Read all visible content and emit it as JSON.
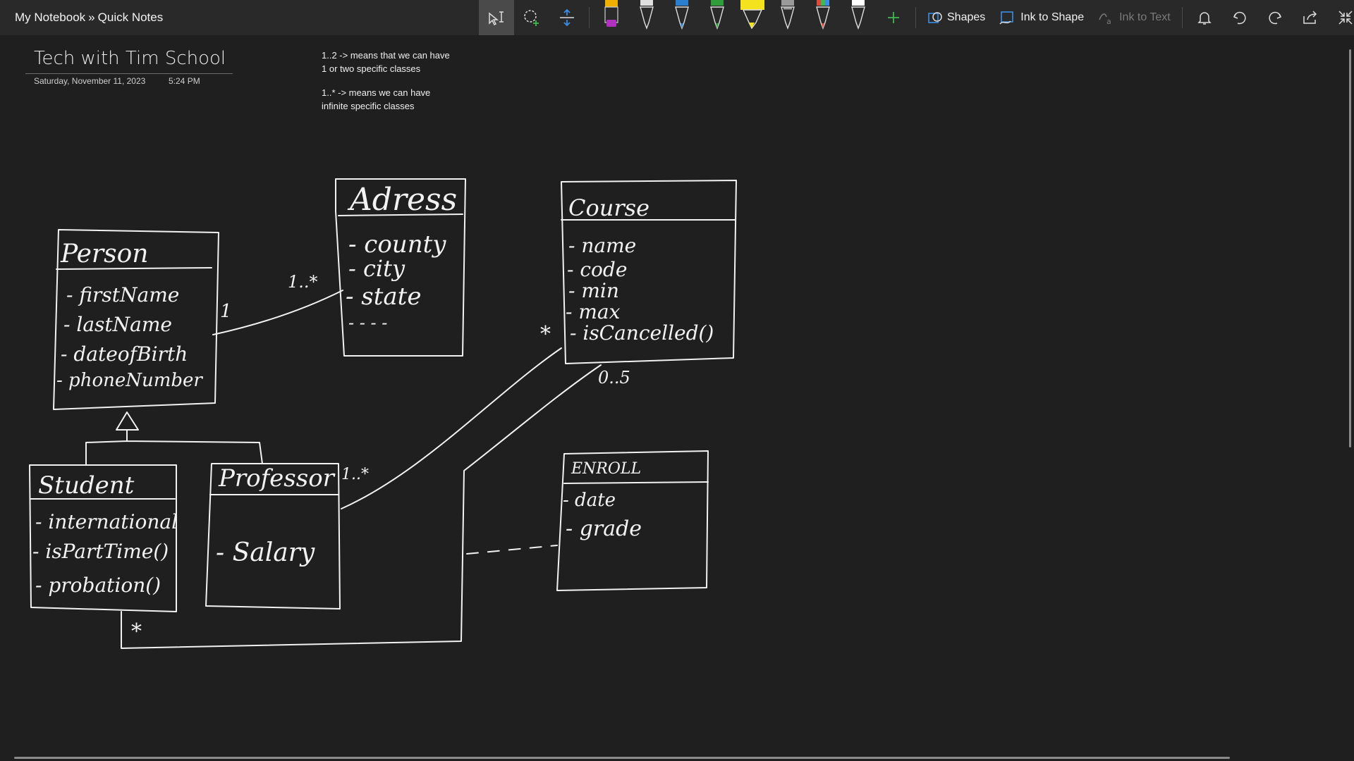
{
  "breadcrumb": {
    "notebook": "My Notebook",
    "separator": "»",
    "section": "Quick Notes"
  },
  "toolbar": {
    "shapes_label": "Shapes",
    "ink_to_shape_label": "Ink to Shape",
    "ink_to_text_label": "Ink to Text",
    "pens": [
      {
        "color": "#f0b000",
        "accent": "#b030c0"
      },
      {
        "color": "#e0e0e0",
        "accent": "#e0e0e0"
      },
      {
        "color": "#2a7fd0",
        "accent": "#2a7fd0"
      },
      {
        "color": "#2f9d3a",
        "accent": "#2f9d3a"
      },
      {
        "color": "#f3e21c",
        "accent": "#f3e21c"
      },
      {
        "color": "#c8c8c8",
        "accent": "#c8c8c8"
      },
      {
        "color": "#d94b3a",
        "accent": "#30a0e0"
      },
      {
        "color": "#ffffff",
        "accent": "#ffffff"
      }
    ],
    "add_pen_color": "#3fb950"
  },
  "page": {
    "title": "Tech with Tim School",
    "date": "Saturday, November 11, 2023",
    "time": "5:24 PM"
  },
  "notes": [
    {
      "line1": "1..2 -> means that we can have",
      "line2": "1 or two specific classes"
    },
    {
      "line1": "1..* -> means we can have",
      "line2": "infinite specific classes"
    }
  ],
  "ink": {
    "person": {
      "title": "Person",
      "fields": [
        "- firstName",
        "- lastName",
        "- dateofBirth",
        "- phoneNumber"
      ]
    },
    "address": {
      "title": "Adress",
      "fields": [
        "- county",
        "- city",
        "- state",
        "- - - -"
      ]
    },
    "course": {
      "title": "Course",
      "fields": [
        "- name",
        "- code",
        "- min",
        "- max",
        "- isCancelled()"
      ]
    },
    "student": {
      "title": "Student",
      "fields": [
        "- international",
        "- isPartTime()",
        "- probation()"
      ]
    },
    "professor": {
      "title": "Professor",
      "fields": [
        "- Salary"
      ]
    },
    "enroll": {
      "title": "ENROLL",
      "fields": [
        "- date",
        "- grade"
      ]
    },
    "multiplicity": {
      "person_address_person": "1",
      "person_address_address": "1..*",
      "professor_course": "1..*",
      "course_zero_five": "0..5",
      "course_star": "*",
      "student_star": "*"
    }
  }
}
